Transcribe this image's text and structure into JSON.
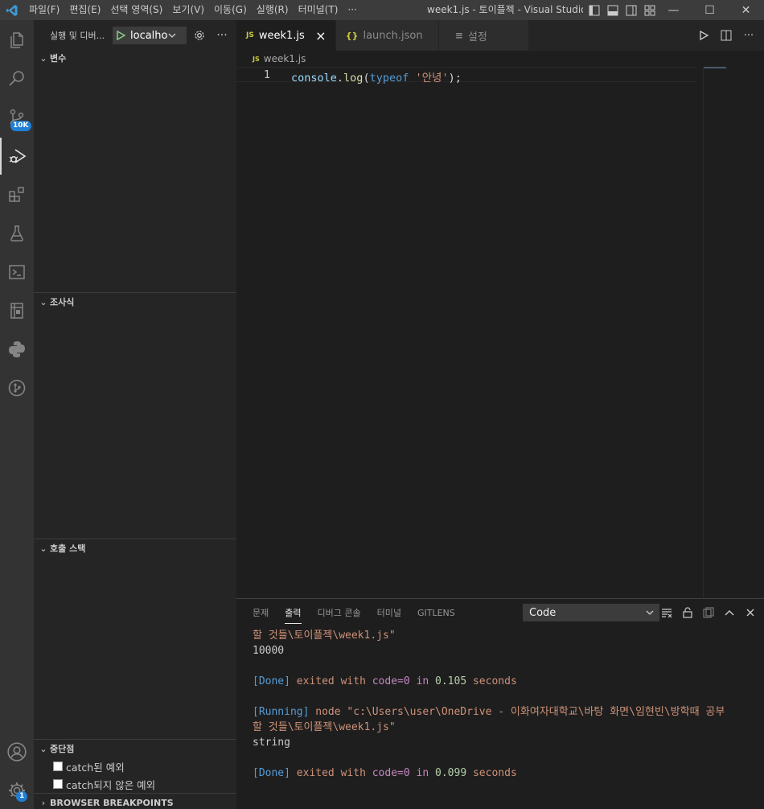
{
  "titlebar": {
    "menu": [
      "파일(F)",
      "편집(E)",
      "선택 영역(S)",
      "보기(V)",
      "이동(G)",
      "실행(R)",
      "터미널(T)",
      "···"
    ],
    "title": "week1.js - 토이플젝 - Visual Studio..."
  },
  "activity": {
    "source_control_badge": "10K",
    "accounts_badge": "1",
    "icons": [
      "explorer-icon",
      "search-icon",
      "source-control-icon",
      "run-debug-icon",
      "extensions-icon",
      "testing-icon",
      "remote-explorer-icon",
      "notebook-icon",
      "python-icon",
      "gitlens-icon",
      "account-icon",
      "manage-gear-icon"
    ]
  },
  "sidebar": {
    "title": "실행 및 디버...",
    "config": "localho",
    "sections": {
      "variables": "변수",
      "watch": "조사식",
      "call_stack": "호출 스택",
      "breakpoints": "중단점",
      "browser_breakpoints": "BROWSER BREAKPOINTS"
    },
    "breakpoint_items": [
      "catch된 예외",
      "catch되지 않은 예외"
    ]
  },
  "editor": {
    "tabs": [
      {
        "icon": "JS",
        "label": "week1.js",
        "active": true
      },
      {
        "icon": "{}",
        "label": "launch.json",
        "active": false
      },
      {
        "icon": "≡",
        "label": "설정",
        "active": false
      }
    ],
    "breadcrumb": {
      "icon": "JS",
      "file": "week1.js"
    },
    "line_number": "1",
    "code": {
      "obj": "console",
      "dot": ".",
      "fn": "log",
      "paren_open": "(",
      "kw": "typeof",
      "space": " ",
      "str": "'안녕'",
      "tail": ");"
    }
  },
  "panel": {
    "tabs": [
      "문제",
      "출력",
      "디버그 콘솔",
      "터미널",
      "GITLENS"
    ],
    "active_tab": "출력",
    "output_channel": "Code",
    "output": {
      "l1": "할 것들\\토이플젝\\week1.js\"",
      "l2": "10000",
      "done1": {
        "tag": "[Done]",
        "a": "exited",
        "b": "with",
        "c": "code=0",
        "d": "in",
        "e": "0.105",
        "f": "seconds"
      },
      "running": {
        "tag": "[Running]",
        "cmd": "node \"c:\\Users\\user\\OneDrive - 이화여자대학교\\바탕 화면\\임현빈\\방학때 공부"
      },
      "l5": "할 것들\\토이플젝\\week1.js\"",
      "l6": "string",
      "done2": {
        "tag": "[Done]",
        "a": "exited",
        "b": "with",
        "c": "code=0",
        "d": "in",
        "e": "0.099",
        "f": "seconds"
      }
    }
  }
}
